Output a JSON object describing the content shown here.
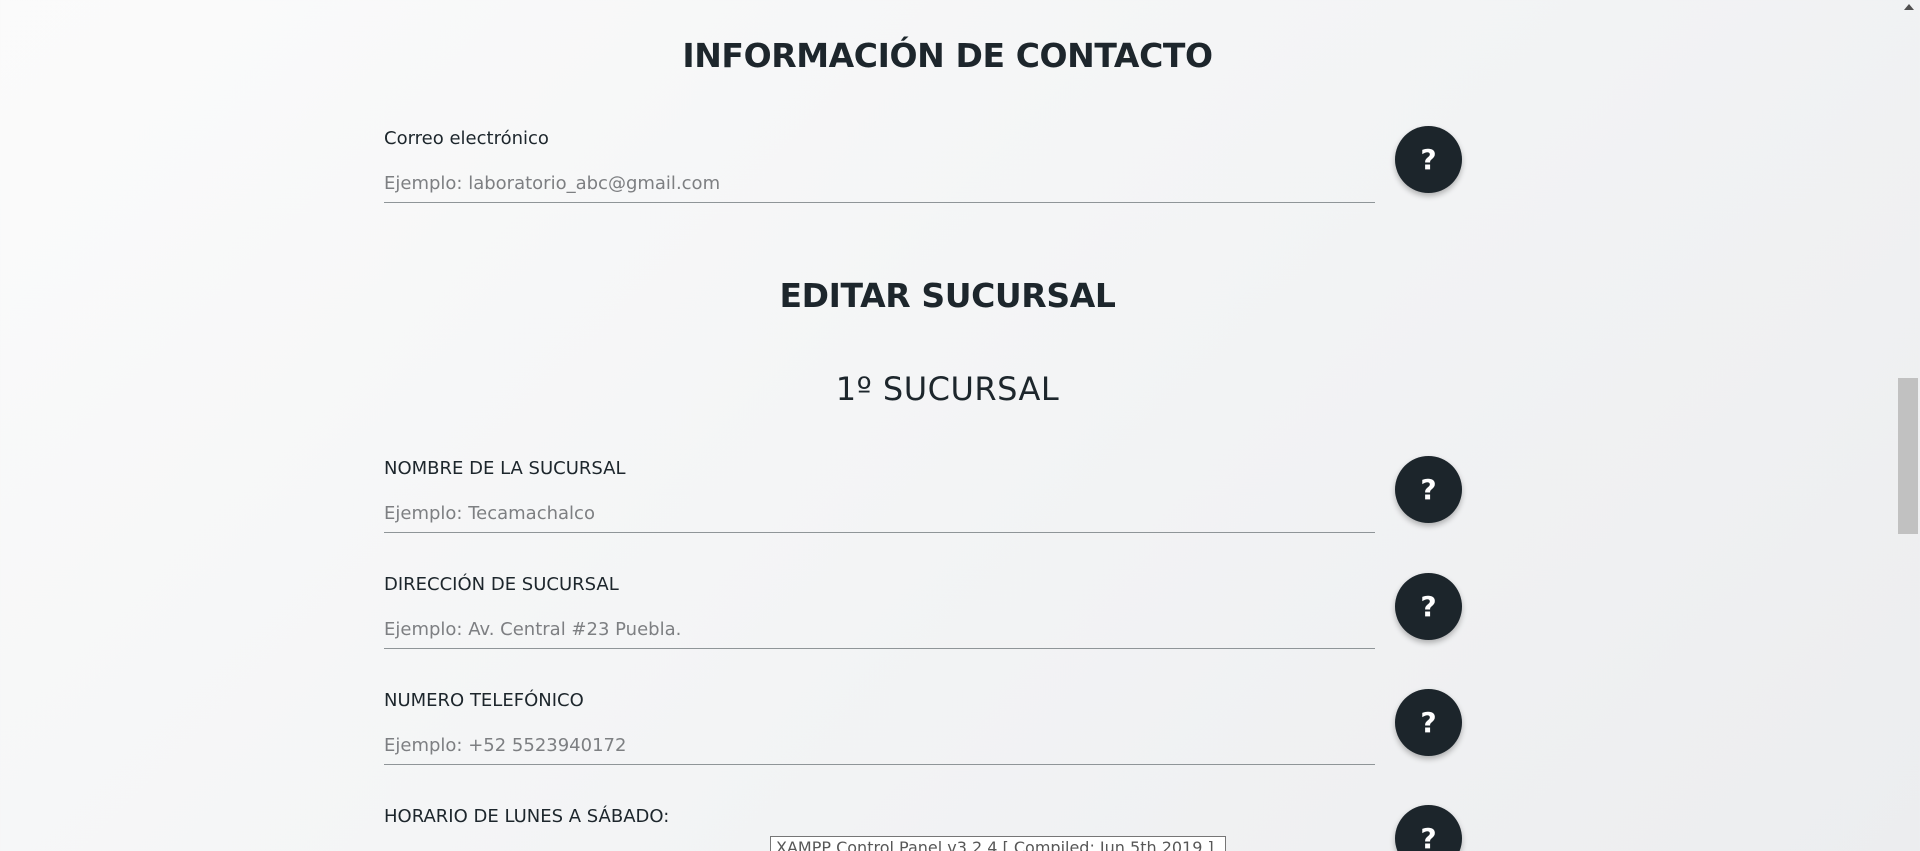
{
  "contact_section": {
    "title": "INFORMACIÓN DE CONTACTO",
    "email_label": "Correo electrónico",
    "email_placeholder": "Ejemplo: laboratorio_abc@gmail.com",
    "help": "?"
  },
  "edit_section": {
    "title": "EDITAR SUCURSAL",
    "branch_title": "1º SUCURSAL",
    "fields": [
      {
        "label": "NOMBRE DE LA SUCURSAL",
        "placeholder": "Ejemplo: Tecamachalco",
        "help": "?"
      },
      {
        "label": "DIRECCIÓN DE SUCURSAL",
        "placeholder": "Ejemplo: Av. Central #23 Puebla.",
        "help": "?"
      },
      {
        "label": "NUMERO TELEFÓNICO",
        "placeholder": "Ejemplo: +52 5523940172",
        "help": "?"
      },
      {
        "label": "HORARIO DE LUNES A SÁBADO:",
        "help": "?"
      }
    ]
  },
  "tooltip": {
    "text": "XAMPP Control Panel v3.2.4   [ Compiled: Jun 5th 2019 ]"
  },
  "icons": {
    "help": "question-mark-icon",
    "scroll_up": "arrow-up-icon"
  },
  "colors": {
    "button_bg": "#1c252b",
    "heading": "#1d262c",
    "placeholder": "#7d7f82"
  }
}
